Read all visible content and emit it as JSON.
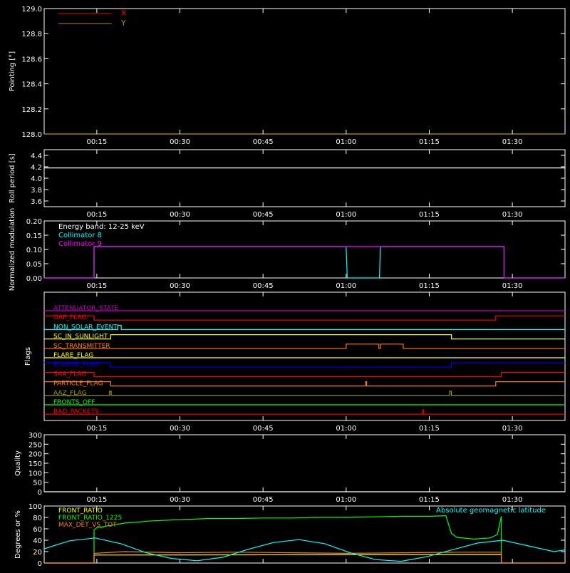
{
  "time_ticks": [
    "00:15",
    "00:30",
    "00:45",
    "01:00",
    "01:15",
    "01:30"
  ],
  "time_tick_minutes": [
    15,
    30,
    45,
    60,
    75,
    90
  ],
  "time_range_minutes": [
    5.5,
    99.5
  ],
  "colors": {
    "axes": "#ffffff",
    "red": "#ff0000",
    "olive": "#999900",
    "cyan": "#00ffff",
    "magenta": "#ff00ff",
    "yellow": "#ffff00",
    "orange": "#ff7f00",
    "blue": "#0000ff",
    "green": "#00ff00",
    "purple": "#c000c0",
    "olive_flag": "#a0a000"
  },
  "chart_data": [
    {
      "id": "pointing",
      "type": "line",
      "ylabel": "Pointing [°]",
      "ylim": [
        128.0,
        129.0
      ],
      "yticks": [
        "129.0",
        "128.8",
        "128.6",
        "128.4",
        "128.2",
        "128.0"
      ],
      "ytick_values": [
        129.0,
        128.8,
        128.6,
        128.4,
        128.2,
        128.0
      ],
      "series": [
        {
          "name": "X",
          "color": "#ff0000",
          "x": [
            5.5,
            99.5
          ],
          "y": [
            128.0,
            128.0
          ]
        },
        {
          "name": "Y",
          "color": "#999900",
          "x": [
            5.5,
            99.5
          ],
          "y": [
            128.0,
            128.0
          ]
        }
      ]
    },
    {
      "id": "roll",
      "type": "line",
      "ylabel": "Roll period [s]",
      "ylim": [
        3.5,
        4.5
      ],
      "yticks": [
        "4.4",
        "4.2",
        "4.0",
        "3.8",
        "3.6"
      ],
      "ytick_values": [
        4.4,
        4.2,
        4.0,
        3.8,
        3.6
      ],
      "series": [
        {
          "name": "roll",
          "color": "#ffffff",
          "x": [
            5.5,
            99.5
          ],
          "y": [
            4.18,
            4.18
          ]
        }
      ]
    },
    {
      "id": "modulation",
      "type": "line",
      "ylabel": "Normalized modulation",
      "ylim": [
        0.0,
        0.2
      ],
      "yticks": [
        "0.20",
        "0.15",
        "0.10",
        "0.05",
        "0.00"
      ],
      "ytick_values": [
        0.2,
        0.15,
        0.1,
        0.05,
        0.0
      ],
      "annotation": "Energy band: 12-25 keV",
      "series": [
        {
          "name": "Collimator 8",
          "color": "#00ffff",
          "x": [
            5.5,
            14.5,
            14.5,
            60.0,
            60.2,
            66.0,
            66.2,
            88.5,
            88.5,
            99.5
          ],
          "y": [
            0.0,
            0.0,
            0.11,
            0.11,
            0.0,
            0.0,
            0.11,
            0.11,
            0.0,
            0.0
          ]
        },
        {
          "name": "Collimator 9",
          "color": "#ff00ff",
          "x": [
            5.5,
            14.5,
            14.5,
            88.5,
            88.5,
            99.5
          ],
          "y": [
            0.0,
            0.0,
            0.11,
            0.11,
            0.0,
            0.0
          ]
        }
      ]
    },
    {
      "id": "flags",
      "type": "line",
      "ylabel": "Flags",
      "flags": [
        {
          "name": "ATTENUATOR_STATE",
          "color": "#c000c0",
          "x": [
            5.5,
            99.5
          ],
          "y": [
            0,
            0
          ]
        },
        {
          "name": "GAP_FLAG",
          "color": "#ff0000",
          "x": [
            5.5,
            14.5,
            14.5,
            87.0,
            87.0,
            99.5
          ],
          "y": [
            1,
            1,
            0,
            0,
            1,
            1
          ]
        },
        {
          "name": "NON_SOLAR_EVENT",
          "color": "#00ffff",
          "x": [
            5.5,
            18.8,
            18.8,
            19.4,
            19.4,
            99.5
          ],
          "y": [
            0,
            0,
            1,
            1,
            0,
            0
          ]
        },
        {
          "name": "SC_IN_SUNLIGHT",
          "color": "#ffff00",
          "x": [
            5.5,
            17.5,
            17.5,
            79.0,
            79.0,
            99.5
          ],
          "y": [
            0,
            0,
            1,
            1,
            0,
            0
          ]
        },
        {
          "name": "SC_TRANSMITTER",
          "color": "#ff7f00",
          "x": [
            5.5,
            60.0,
            60.0,
            65.9,
            65.9,
            66.2,
            66.2,
            70.3,
            70.3,
            99.5
          ],
          "y": [
            0,
            0,
            1,
            1,
            0,
            0,
            1,
            1,
            0,
            0
          ]
        },
        {
          "name": "FLARE_FLAG",
          "color": "#ffff00",
          "x": [
            5.5,
            99.5
          ],
          "y": [
            0,
            0
          ]
        },
        {
          "name": "ECLIPSE_FLAG",
          "color": "#0000ff",
          "x": [
            5.5,
            17.5,
            17.5,
            79.0,
            79.0,
            99.5
          ],
          "y": [
            1,
            1,
            0,
            0,
            1,
            1
          ]
        },
        {
          "name": "SAA_FLAG",
          "color": "#ff0000",
          "x": [
            5.5,
            14.5,
            14.5,
            88.0,
            88.0,
            99.5
          ],
          "y": [
            1,
            1,
            0,
            0,
            1,
            1
          ]
        },
        {
          "name": "PARTICLE_FLAG",
          "color": "#ff7f00",
          "x": [
            5.5,
            17.5,
            17.5,
            63.5,
            63.5,
            63.7,
            63.7,
            87.0,
            87.0,
            99.5
          ],
          "y": [
            1,
            1,
            0,
            0,
            1,
            1,
            0,
            0,
            1,
            1
          ]
        },
        {
          "name": "AAZ_FLAG",
          "color": "#a0a000",
          "x": [
            5.5,
            17.3,
            17.3,
            17.6,
            17.6,
            78.7,
            78.7,
            79.0,
            79.0,
            99.5
          ],
          "y": [
            0,
            0,
            1,
            1,
            0,
            0,
            1,
            1,
            0,
            0
          ]
        },
        {
          "name": "FRONTS_OFF",
          "color": "#00ff00",
          "x": [
            5.5,
            99.5
          ],
          "y": [
            0,
            0
          ]
        },
        {
          "name": "BAD_PACKETS",
          "color": "#ff0000",
          "x": [
            5.5,
            73.8,
            73.8,
            74.0,
            74.0,
            99.5
          ],
          "y": [
            0,
            0,
            1,
            1,
            0,
            0
          ]
        }
      ]
    },
    {
      "id": "quality",
      "type": "line",
      "ylabel": "Quality",
      "ylim": [
        0,
        300
      ],
      "yticks": [
        "300",
        "250",
        "200",
        "150",
        "100",
        "50",
        "0"
      ],
      "ytick_values": [
        300,
        250,
        200,
        150,
        100,
        50,
        0
      ],
      "series": [
        {
          "name": "quality",
          "color": "#ffffff",
          "x": [
            5.5,
            99.5
          ],
          "y": [
            0,
            0
          ]
        }
      ]
    },
    {
      "id": "fronts",
      "type": "line",
      "ylabel": "Degrees or %",
      "ylim": [
        0,
        100
      ],
      "yticks": [
        "100",
        "80",
        "60",
        "40",
        "20",
        "0"
      ],
      "ytick_values": [
        100,
        80,
        60,
        40,
        20,
        0
      ],
      "annotation": "Absolute geomagnetic latitude",
      "series": [
        {
          "name": "FRONT_RATIO",
          "color": "#ffff00",
          "x": [
            5.5,
            14.5,
            14.5,
            88.0,
            88.0,
            99.5
          ],
          "y": [
            0,
            0,
            14,
            15,
            0,
            0
          ]
        },
        {
          "name": "FRONT_RATIO_1225",
          "color": "#00ff00",
          "x": [
            5.5,
            14.5,
            14.5,
            15,
            20,
            25,
            30,
            35,
            40,
            45,
            50,
            55,
            60,
            65,
            70,
            75,
            78,
            79,
            80,
            83,
            86,
            87.3,
            88.0,
            88.0,
            99.5
          ],
          "y": [
            0,
            0,
            58,
            62,
            70,
            74,
            76,
            78,
            78,
            79,
            79,
            80,
            80,
            81,
            82,
            82,
            83,
            52,
            45,
            42,
            44,
            50,
            82,
            0,
            0
          ]
        },
        {
          "name": "MAX_DET_VS_TOT",
          "color": "#ff7f00",
          "x": [
            5.5,
            14.5,
            14.5,
            20,
            30,
            40,
            50,
            60,
            70,
            80,
            88.0,
            88.0,
            99.5
          ],
          "y": [
            0,
            0,
            17,
            20,
            18,
            19,
            18,
            17,
            18,
            19,
            19,
            0,
            0
          ]
        },
        {
          "name": "Absolute geomagnetic latitude",
          "color": "#00ffff",
          "x": [
            5.5,
            10.1,
            14.7,
            19.3,
            23.9,
            28.5,
            33.1,
            37.7,
            42.3,
            46.9,
            51.5,
            56.1,
            60.7,
            65.3,
            69.9,
            74.5,
            79.1,
            83.7,
            88.3,
            92.9,
            97.5,
            99.5
          ],
          "y": [
            25,
            39,
            44,
            34,
            18,
            8,
            4,
            10,
            24,
            36,
            41,
            34,
            18,
            6,
            3,
            11,
            23,
            35,
            40,
            30,
            20,
            23
          ]
        }
      ]
    }
  ]
}
